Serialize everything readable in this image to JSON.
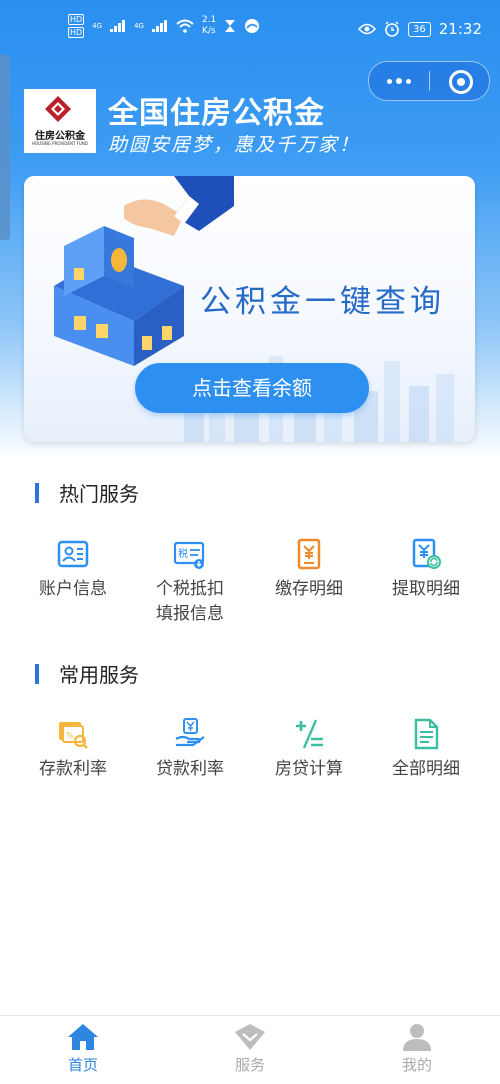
{
  "status_bar": {
    "net_speed_value": "2.1",
    "net_speed_unit": "K/s",
    "battery": "36",
    "time": "21:32",
    "hd1": "HD",
    "hd2": "HD",
    "sig1": "4G",
    "sig2": "4G"
  },
  "header": {
    "logo_text": "住房公积金",
    "logo_subtext": "HOUSING PROVIDENT FUND",
    "title": "全国住房公积金",
    "slogan": "助圆安居梦，惠及千万家！"
  },
  "banner": {
    "title": "公积金一键查询",
    "button_label": "点击查看余额"
  },
  "hot_services": {
    "title": "热门服务",
    "items": [
      {
        "label": "账户信息",
        "icon": "id-card-icon"
      },
      {
        "label": "个税抵扣\n填报信息",
        "icon": "tax-icon"
      },
      {
        "label": "缴存明细",
        "icon": "deposit-detail-icon"
      },
      {
        "label": "提取明细",
        "icon": "withdraw-detail-icon"
      }
    ]
  },
  "common_services": {
    "title": "常用服务",
    "items": [
      {
        "label": "存款利率",
        "icon": "deposit-rate-icon"
      },
      {
        "label": "贷款利率",
        "icon": "loan-rate-icon"
      },
      {
        "label": "房贷计算",
        "icon": "calculator-icon"
      },
      {
        "label": "全部明细",
        "icon": "document-icon"
      }
    ]
  },
  "tabbar": {
    "items": [
      {
        "label": "首页",
        "icon": "home-icon",
        "active": true
      },
      {
        "label": "服务",
        "icon": "service-icon",
        "active": false
      },
      {
        "label": "我的",
        "icon": "profile-icon",
        "active": false
      }
    ]
  },
  "colors": {
    "primary": "#2d8ff0",
    "orange": "#ef8a2b",
    "teal": "#3cbfa0"
  }
}
